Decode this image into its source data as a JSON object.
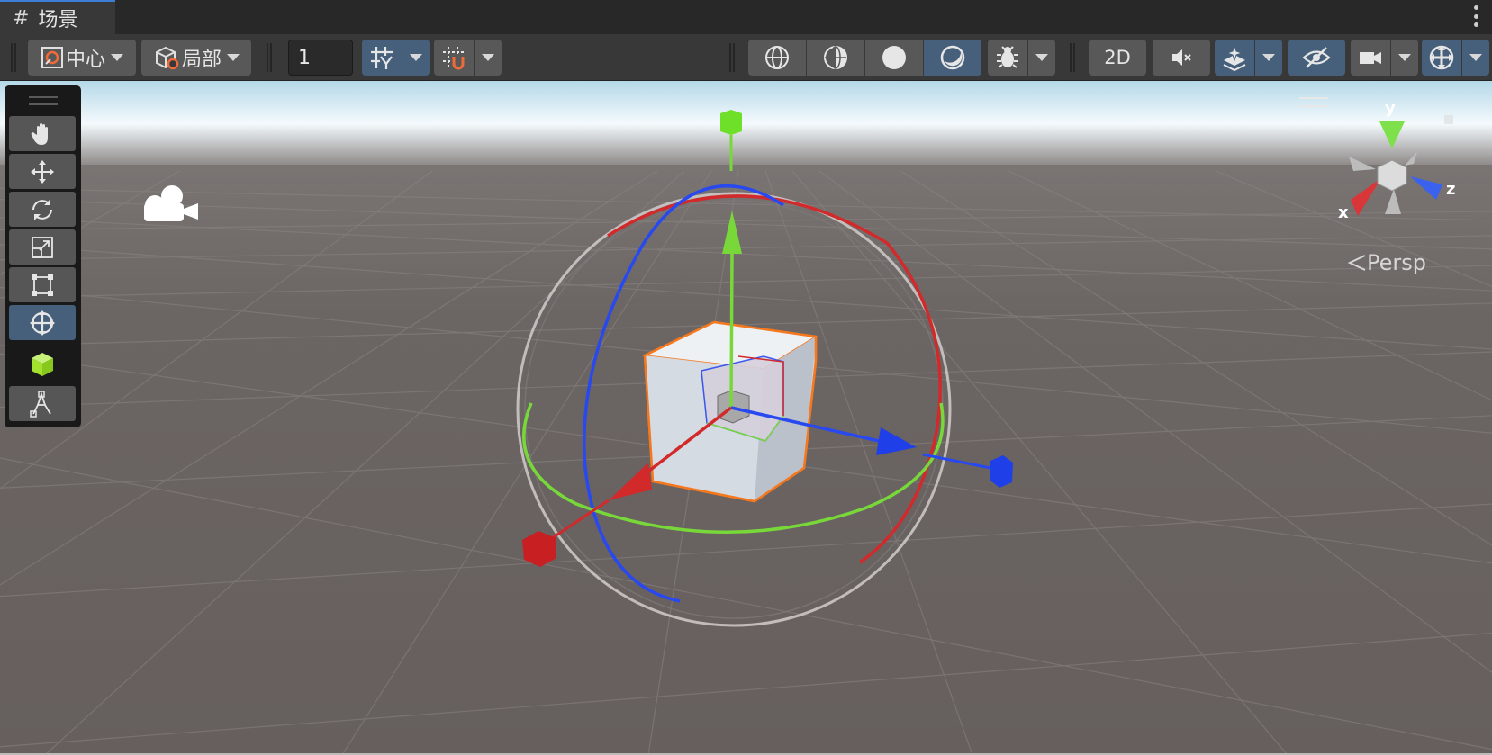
{
  "tab": {
    "icon": "#",
    "title": "场景"
  },
  "toolbar": {
    "pivot_label": "中心",
    "space_label": "局部",
    "grid_size_value": "1",
    "toggle_2d_label": "2D"
  },
  "gizmo": {
    "x_label": "x",
    "y_label": "y",
    "z_label": "z",
    "persp_label": "Persp"
  },
  "colors": {
    "toolbar_bg": "#383838",
    "button_bg": "#585858",
    "button_active_bg": "#46607c",
    "ground": "#6a6462",
    "x_axis": "#d2292b",
    "y_axis": "#78d83a",
    "z_axis": "#2848f0",
    "selection_outline": "#f5781e"
  },
  "icons": {
    "tab": "scene-hash-icon",
    "pivot": "pivot-center-icon",
    "space": "local-space-icon",
    "toolbox": [
      "hand-icon",
      "move-icon",
      "rotate-icon",
      "scale-icon",
      "rect-icon",
      "transform-icon",
      "custom-cube-icon",
      "path-tool-icon"
    ]
  }
}
